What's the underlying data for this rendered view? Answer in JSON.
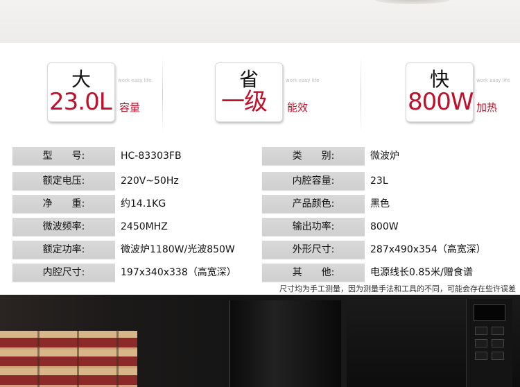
{
  "features": [
    {
      "char": "大",
      "value": "23.0L",
      "label": "容量",
      "watermark": "work easy life"
    },
    {
      "char": "省",
      "value": "一级",
      "label": "能效",
      "watermark": "work easy life"
    },
    {
      "char": "快",
      "value": "800W",
      "label": "加热",
      "watermark": "work easy life"
    }
  ],
  "specs": [
    [
      {
        "label": "型　　号:",
        "value": "HC-83303FB"
      },
      {
        "label": "类　　别:",
        "value": "微波炉"
      }
    ],
    [
      {
        "label": "额定电压:",
        "value": "220V~50Hz"
      },
      {
        "label": "内腔容量:",
        "value": "23L"
      }
    ],
    [
      {
        "label": "净　　重:",
        "value": "约14.1KG"
      },
      {
        "label": "产品颜色:",
        "value": "黑色"
      }
    ],
    [
      {
        "label": "微波频率:",
        "value": "2450MHZ"
      },
      {
        "label": "输出功率:",
        "value": "800W"
      }
    ],
    [
      {
        "label": "额定功率:",
        "value": "微波炉1180W/光波850W"
      },
      {
        "label": "外形尺寸:",
        "value": "287x490x354（高宽深）"
      }
    ],
    [
      {
        "label": "内腔尺寸:",
        "value": "197x340x338（高宽深）"
      },
      {
        "label": "其　　他:",
        "value": "电源线长0.85米/赠食谱"
      }
    ]
  ],
  "footnote": "尺寸均为手工测量，因为测量手法和工具的不同，可能会存在些许误差",
  "colors": {
    "accent_red": "#c0102a",
    "label_bg": "#d4d4d4"
  }
}
